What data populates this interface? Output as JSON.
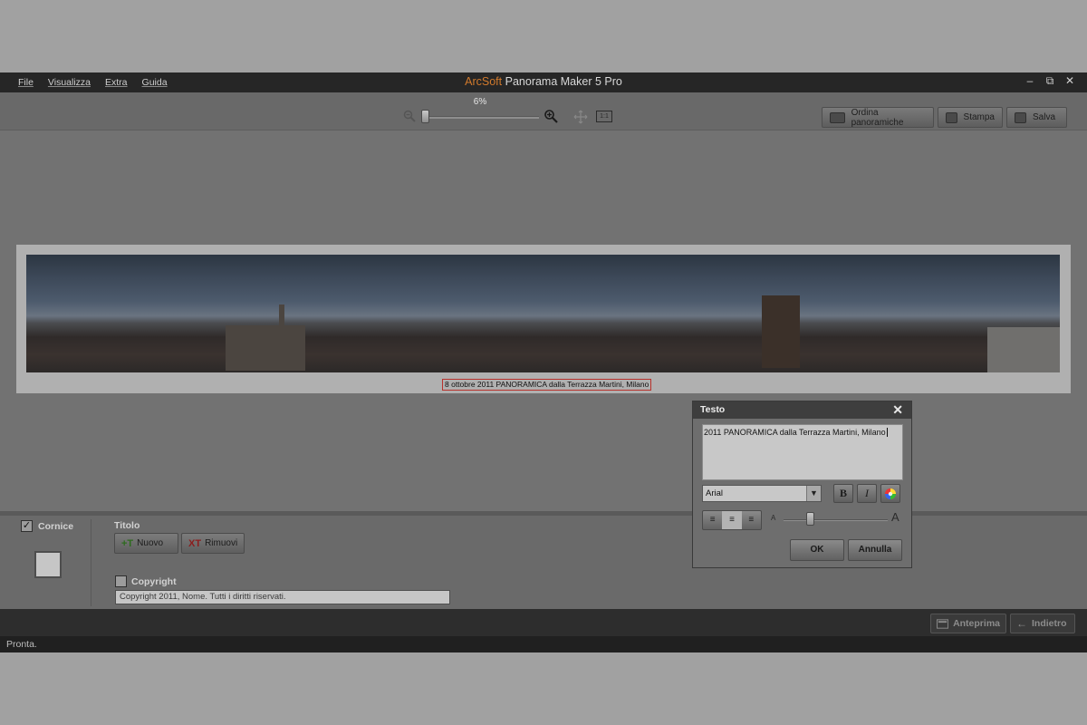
{
  "menu": [
    "File",
    "Visualizza",
    "Extra",
    "Guida"
  ],
  "app_title": {
    "brand": "ArcSoft",
    "product": "Panorama Maker 5 Pro"
  },
  "window_controls": {
    "minimize": "–",
    "restore": "⧉",
    "close": "✕"
  },
  "toolbar": {
    "zoom_percent": "6%",
    "zoom_level": 0.06,
    "one_to_one": "1:1",
    "buttons": {
      "order": "Ordina panoramiche",
      "print": "Stampa",
      "save": "Salva"
    }
  },
  "caption": "8 ottobre 2011 PANORAMICA dalla Terrazza Martini, Milano",
  "bottom_panel": {
    "frame_label": "Cornice",
    "frame_checked": true,
    "title_label": "Titolo",
    "new_label": "Nuovo",
    "remove_label": "Rimuovi",
    "copyright_label": "Copyright",
    "copyright_checked": false,
    "copyright_value": "Copyright 2011, Nome. Tutti i diritti riservati."
  },
  "nav": {
    "preview": "Anteprima",
    "back": "Indietro"
  },
  "status": "Pronta.",
  "dialog": {
    "title": "Testo",
    "text_value": "2011 PANORAMICA dalla Terrazza Martini, Milano",
    "font": "Arial",
    "bold": "B",
    "italic": "I",
    "size_small": "A",
    "size_large": "A",
    "ok": "OK",
    "cancel": "Annulla"
  },
  "colors": {
    "brand_orange": "#d27a2c",
    "caption_border": "#b8322c",
    "title_bar": "#262626"
  }
}
